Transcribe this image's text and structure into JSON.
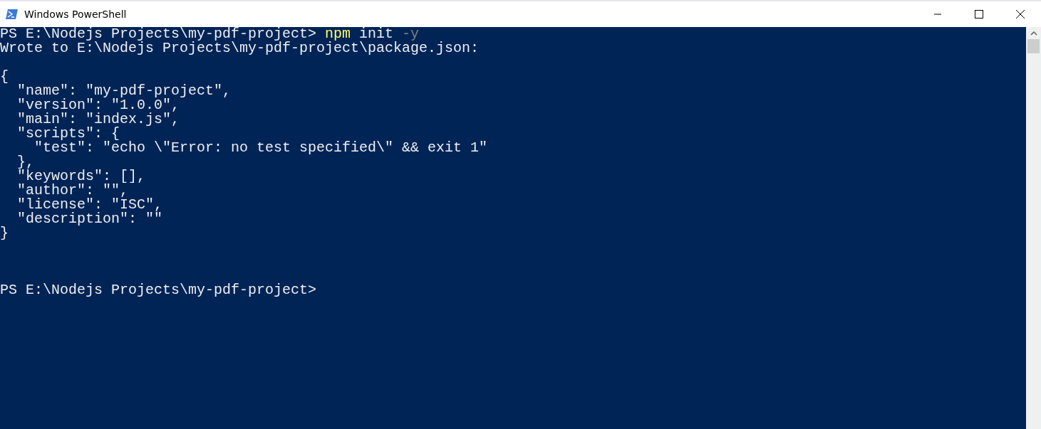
{
  "window": {
    "title": "Windows PowerShell"
  },
  "console": {
    "lines": [
      {
        "kind": "text",
        "segments": [
          {
            "kind": "prompt",
            "text": "PS E:\\Nodejs Projects\\my-pdf-project> "
          },
          {
            "kind": "command",
            "text": "npm"
          },
          {
            "kind": "prompt",
            "text": " init "
          },
          {
            "kind": "parameter",
            "text": "-y"
          }
        ]
      },
      {
        "kind": "text",
        "segments": [
          {
            "kind": "output",
            "text": "Wrote to E:\\Nodejs Projects\\my-pdf-project\\package.json:"
          }
        ]
      },
      {
        "kind": "blank"
      },
      {
        "kind": "text",
        "segments": [
          {
            "kind": "output",
            "text": "{"
          }
        ]
      },
      {
        "kind": "text",
        "segments": [
          {
            "kind": "output",
            "text": "  \"name\": \"my-pdf-project\","
          }
        ]
      },
      {
        "kind": "text",
        "segments": [
          {
            "kind": "output",
            "text": "  \"version\": \"1.0.0\","
          }
        ]
      },
      {
        "kind": "text",
        "segments": [
          {
            "kind": "output",
            "text": "  \"main\": \"index.js\","
          }
        ]
      },
      {
        "kind": "text",
        "segments": [
          {
            "kind": "output",
            "text": "  \"scripts\": {"
          }
        ]
      },
      {
        "kind": "text",
        "segments": [
          {
            "kind": "output",
            "text": "    \"test\": \"echo \\\"Error: no test specified\\\" && exit 1\""
          }
        ]
      },
      {
        "kind": "text",
        "segments": [
          {
            "kind": "output",
            "text": "  },"
          }
        ]
      },
      {
        "kind": "text",
        "segments": [
          {
            "kind": "output",
            "text": "  \"keywords\": [],"
          }
        ]
      },
      {
        "kind": "text",
        "segments": [
          {
            "kind": "output",
            "text": "  \"author\": \"\","
          }
        ]
      },
      {
        "kind": "text",
        "segments": [
          {
            "kind": "output",
            "text": "  \"license\": \"ISC\","
          }
        ]
      },
      {
        "kind": "text",
        "segments": [
          {
            "kind": "output",
            "text": "  \"description\": \"\""
          }
        ]
      },
      {
        "kind": "text",
        "segments": [
          {
            "kind": "output",
            "text": "}"
          }
        ]
      },
      {
        "kind": "blank"
      },
      {
        "kind": "blank"
      },
      {
        "kind": "blank"
      },
      {
        "kind": "text",
        "segments": [
          {
            "kind": "prompt",
            "text": "PS E:\\Nodejs Projects\\my-pdf-project>"
          }
        ]
      }
    ]
  }
}
